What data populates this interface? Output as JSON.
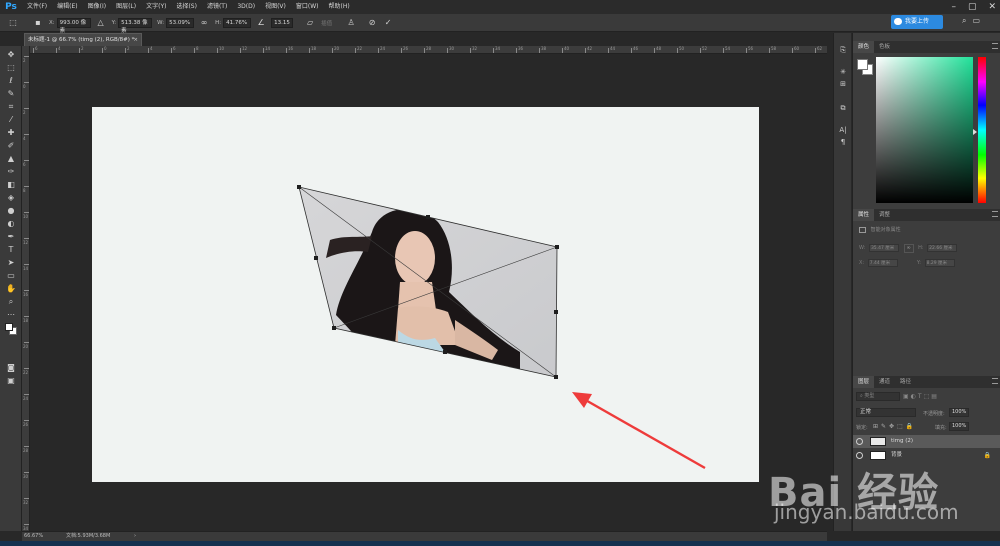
{
  "app": {
    "logo": "Ps"
  },
  "menu": [
    "文件(F)",
    "编辑(E)",
    "图像(I)",
    "图层(L)",
    "文字(Y)",
    "选择(S)",
    "滤镜(T)",
    "3D(D)",
    "视图(V)",
    "窗口(W)",
    "帮助(H)"
  ],
  "window_controls": {
    "minimize": "–",
    "restore": "▢",
    "close": "✕"
  },
  "options": {
    "x_label": "X:",
    "x_value": "993.00 像素",
    "y_label": "Y:",
    "y_value": "513.38 像素",
    "w_label": "W:",
    "w_value": "53.09%",
    "h_label": "H:",
    "h_value": "41.76%",
    "angle_value": "13.15",
    "interp_label": "插值",
    "cloud_button": "我要上传"
  },
  "document": {
    "tab_title": "未标题-1 @ 66.7% (timg (2), RGB/8#) *",
    "close": "×"
  },
  "rulers": {
    "horizontal": [
      "6",
      "4",
      "2",
      "0",
      "2",
      "4",
      "6",
      "8",
      "10",
      "12",
      "14",
      "16",
      "18",
      "20",
      "22",
      "24",
      "26",
      "28",
      "30",
      "32",
      "34",
      "36",
      "38",
      "40",
      "42",
      "44",
      "46",
      "48",
      "50",
      "52",
      "54",
      "56",
      "58",
      "60",
      "62"
    ],
    "vertical": [
      "2",
      "0",
      "2",
      "4",
      "6",
      "8",
      "10",
      "12",
      "14",
      "16",
      "18",
      "20",
      "22",
      "24",
      "26",
      "28",
      "30",
      "32",
      "34"
    ]
  },
  "status": {
    "zoom": "66.67%",
    "doc_info": "文档:5.93M/3.68M",
    "arrow": "›"
  },
  "panels": {
    "color_tabs": [
      "颜色",
      "色板"
    ],
    "properties_tabs": [
      "属性",
      "调整"
    ],
    "properties_title": "智能对象属性",
    "properties": {
      "w_label": "W:",
      "w_value": "35.47 厘米",
      "h_label": "H:",
      "h_value": "22.66 厘米",
      "x_label": "X:",
      "x_value": "7.44 厘米",
      "y_label": "Y:",
      "y_value": "8.29 厘米"
    },
    "layers_tabs": [
      "图层",
      "通道",
      "路径"
    ],
    "layers_kind": "类型",
    "blend_mode": "正常",
    "opacity_label": "不透明度:",
    "opacity_value": "100%",
    "lock_label": "锁定:",
    "fill_label": "填充:",
    "fill_value": "100%",
    "layers": [
      {
        "name": "timg (2)",
        "selected": true
      },
      {
        "name": "背景",
        "selected": false
      }
    ]
  },
  "watermark": {
    "brand": "Bai 经验",
    "url": "jingyan.baidu.com"
  },
  "colors": {
    "accent_blue": "#2c8ae0",
    "arrow_red": "#ee3b3b",
    "ps_blue": "#31a8ff"
  }
}
